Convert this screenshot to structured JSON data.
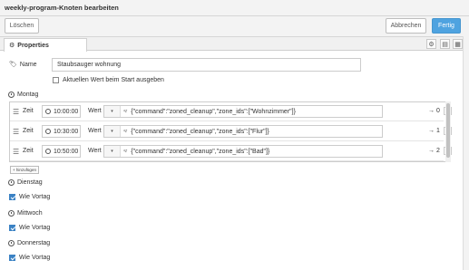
{
  "window": {
    "title": "weekly-program-Knoten bearbeiten"
  },
  "actions": {
    "delete_label": "Löschen",
    "cancel_label": "Abbrechen",
    "done_label": "Fertig"
  },
  "tabs": {
    "properties_label": "Properties"
  },
  "form": {
    "name_label": "Name",
    "name_value": "Staubsauger wohnung",
    "output_start_label": "Aktuellen Wert beim Start ausgeben"
  },
  "days": {
    "monday": {
      "label": "Montag",
      "time_label": "Zeit",
      "value_label": "Wert",
      "rows": [
        {
          "time": "10:00:00",
          "value": "{\"command\":\"zoned_cleanup\",\"zone_ids\":[\"Wohnzimmer\"]}",
          "output": "→ 0"
        },
        {
          "time": "10:30:00",
          "value": "{\"command\":\"zoned_cleanup\",\"zone_ids\":[\"Flur\"]}",
          "output": "→ 1"
        },
        {
          "time": "10:50:00",
          "value": "{\"command\":\"zoned_cleanup\",\"zone_ids\":[\"Bad\"]}",
          "output": "→ 2"
        }
      ],
      "add_label": "+ hinzufügen"
    },
    "tuesday": {
      "label": "Dienstag",
      "same_label": "Wie Vortag"
    },
    "wednesday": {
      "label": "Mittwoch",
      "same_label": "Wie Vortag"
    },
    "thursday": {
      "label": "Donnerstag",
      "same_label": "Wie Vortag"
    }
  },
  "colors": {
    "primary": "#4fa3e0",
    "checkbox": "#3b82c4"
  }
}
